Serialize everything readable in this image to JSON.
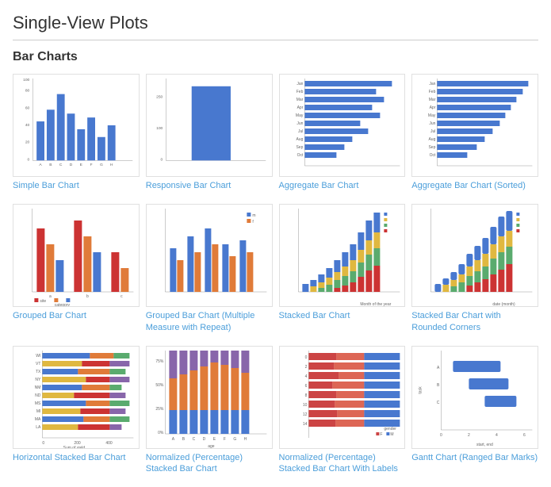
{
  "page": {
    "title": "Single-View Plots",
    "section": "Bar Charts"
  },
  "charts": [
    {
      "id": "simple-bar",
      "label": "Simple Bar Chart"
    },
    {
      "id": "responsive-bar",
      "label": "Responsive Bar Chart"
    },
    {
      "id": "aggregate-bar",
      "label": "Aggregate Bar Chart"
    },
    {
      "id": "aggregate-bar-sorted",
      "label": "Aggregate Bar Chart (Sorted)"
    },
    {
      "id": "grouped-bar",
      "label": "Grouped Bar Chart"
    },
    {
      "id": "grouped-bar-multiple",
      "label": "Grouped Bar Chart (Multiple Measure with Repeat)"
    },
    {
      "id": "stacked-bar",
      "label": "Stacked Bar Chart"
    },
    {
      "id": "stacked-bar-rounded",
      "label": "Stacked Bar Chart with Rounded Corners"
    },
    {
      "id": "horizontal-stacked",
      "label": "Horizontal Stacked Bar Chart"
    },
    {
      "id": "normalized-stacked",
      "label": "Normalized (Percentage) Stacked Bar Chart"
    },
    {
      "id": "normalized-stacked-labels",
      "label": "Normalized (Percentage) Stacked Bar Chart With Labels"
    },
    {
      "id": "gantt",
      "label": "Gantt Chart (Ranged Bar Marks)"
    }
  ]
}
